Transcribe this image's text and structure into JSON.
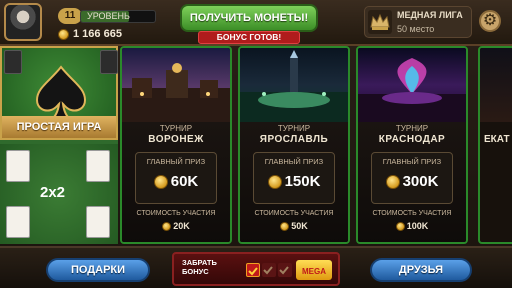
{
  "profile": {
    "level": "11",
    "level_label": "УРОВЕНЬ",
    "level_progress": 0.65,
    "balance": "1 166 665"
  },
  "header": {
    "get_coins_label": "ПОЛУЧИТЬ МОНЕТЫ!",
    "bonus_ready_label": "БОНУС ГОТОВ!"
  },
  "league": {
    "title": "МЕДНАЯ ЛИГА",
    "rank": "50 место"
  },
  "modes": {
    "simple_label": "ПРОСТАЯ ИГРА",
    "pairs_label": "2x2"
  },
  "tournaments": [
    {
      "label": "ТУРНИР",
      "city": "ВОРОНЕЖ",
      "prize_label": "ГЛАВНЫЙ ПРИЗ",
      "prize": "60K",
      "fee_label": "СТОИМОСТЬ УЧАСТИЯ",
      "fee": "20K"
    },
    {
      "label": "ТУРНИР",
      "city": "ЯРОСЛАВЛЬ",
      "prize_label": "ГЛАВНЫЙ ПРИЗ",
      "prize": "150K",
      "fee_label": "СТОИМОСТЬ УЧАСТИЯ",
      "fee": "50K"
    },
    {
      "label": "ТУРНИР",
      "city": "КРАСНОДАР",
      "prize_label": "ГЛАВНЫЙ ПРИЗ",
      "prize": "300K",
      "fee_label": "СТОИМОСТЬ УЧАСТИЯ",
      "fee": "100K"
    },
    {
      "city": "ЕКАТ"
    }
  ],
  "footer": {
    "gifts_label": "ПОДАРКИ",
    "friends_label": "ДРУЗЬЯ",
    "bonus_label": "ЗАБРАТЬ БОНУС",
    "mega_label": "MEGA"
  },
  "colors": {
    "accent_green": "#3c8e27",
    "accent_blue": "#1f5a9e",
    "bonus_red": "#b01c1c",
    "gold": "#c9a24a"
  }
}
